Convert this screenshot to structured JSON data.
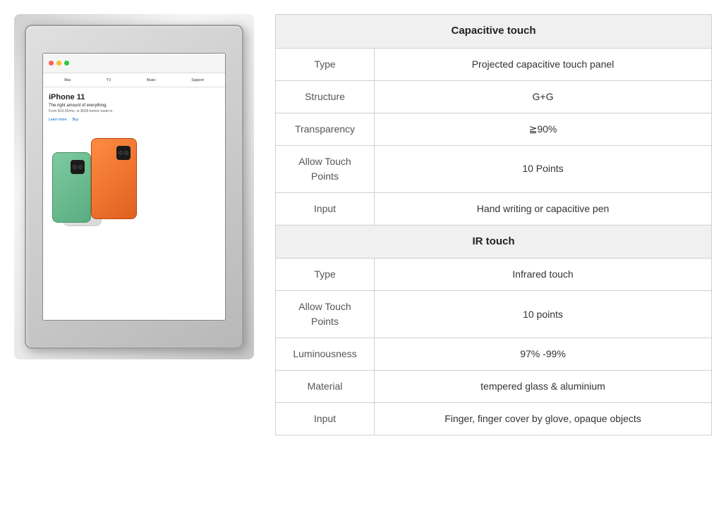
{
  "image": {
    "alt": "Touch monitor device showing iPhone 11 Apple website",
    "iphone_title": "iPhone 11",
    "iphone_subtitle": "The right amount of everything.",
    "iphone_desc": "From $19.95/mo. or $699 before trade-in.",
    "iphone_link1": "Learn more",
    "iphone_link2": "Buy"
  },
  "table": {
    "capacitive_header": "Capacitive touch",
    "ir_header": "IR touch",
    "rows_capacitive": [
      {
        "label": "Type",
        "value": "Projected capacitive touch panel"
      },
      {
        "label": "Structure",
        "value": "G+G"
      },
      {
        "label": "Transparency",
        "value": "≧90%"
      },
      {
        "label": "Allow Touch Points",
        "value": "10 Points"
      },
      {
        "label": "Input",
        "value": "Hand writing or capacitive pen"
      }
    ],
    "rows_ir": [
      {
        "label": "Type",
        "value": "Infrared touch"
      },
      {
        "label": "Allow Touch Points",
        "value": "10 points"
      },
      {
        "label": "Luminousness",
        "value": "97% -99%"
      },
      {
        "label": "Material",
        "value": "tempered glass & aluminium"
      },
      {
        "label": "Input",
        "value": "Finger, finger cover by glove, opaque objects"
      }
    ]
  }
}
